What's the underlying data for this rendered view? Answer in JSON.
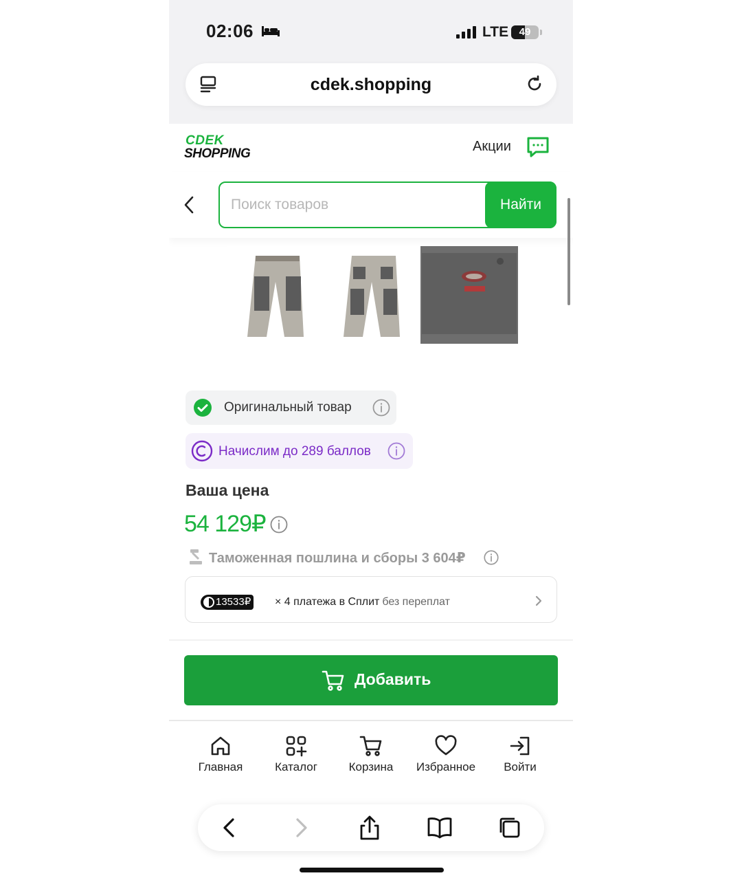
{
  "status_bar": {
    "time": "02:06",
    "network": "LTE",
    "battery_level": "49",
    "icons": [
      "bed-icon",
      "signal-icon",
      "battery-icon"
    ]
  },
  "browser": {
    "url": "cdek.shopping",
    "icons": [
      "reader-icon",
      "reload-icon"
    ]
  },
  "site_header": {
    "logo_line1": "CDEK",
    "logo_line2": "SHOPPING",
    "promo_link": "Акции",
    "brand_color": "#1bb33e"
  },
  "search": {
    "placeholder": "Поиск товаров",
    "value": "",
    "button_label": "Найти"
  },
  "gallery": {
    "thumbnails": [
      "pants-front",
      "pants-back",
      "pocket-logo-detail"
    ]
  },
  "product": {
    "original_badge": "Оригинальный товар",
    "points_badge": "Начислим до 289 баллов",
    "price_label": "Ваша цена",
    "price": "54 129₽",
    "customs": "Таможенная пошлина и сборы 3 604₽",
    "split": {
      "amount": "13533₽",
      "text": "× 4 платежа в Сплит",
      "note": "без переплат"
    },
    "add_button": "Добавить",
    "accent_points": "#7b2bc7"
  },
  "bottom_nav": [
    {
      "label": "Главная",
      "icon": "home-icon"
    },
    {
      "label": "Каталог",
      "icon": "catalog-icon"
    },
    {
      "label": "Корзина",
      "icon": "cart-icon"
    },
    {
      "label": "Избранное",
      "icon": "heart-icon"
    },
    {
      "label": "Войти",
      "icon": "login-icon"
    }
  ],
  "safari_toolbar": [
    "back-icon",
    "forward-icon",
    "share-icon",
    "bookmarks-icon",
    "tabs-icon"
  ]
}
